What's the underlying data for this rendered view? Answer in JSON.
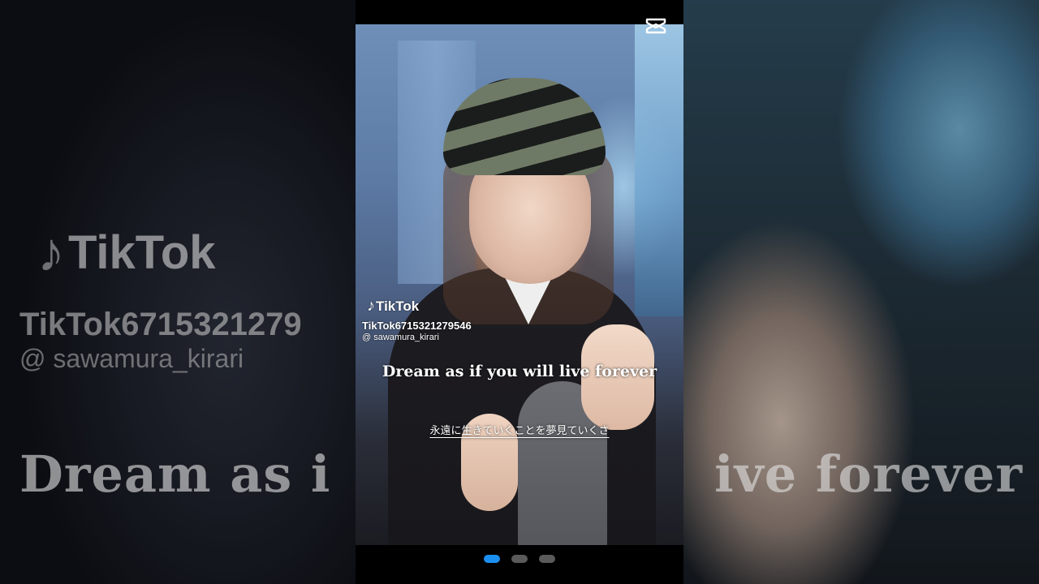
{
  "overlay": {
    "brand": "TikTok",
    "tiktok_id": "TikTok6715321279546",
    "username": "@ sawamura_kirari",
    "caption_en": "Dream as if you will live forever",
    "caption_ja": "永遠に生きていくことを夢見ていくさ"
  },
  "background": {
    "brand": "TikTok",
    "tiktok_id": "TikTok6715321279",
    "username": "@ sawamura_kirari",
    "caption_left": "Dream as i",
    "caption_right": "ive forever"
  },
  "carousel": {
    "count": 3,
    "active_index": 0
  },
  "icons": {
    "watermark": "capcut-logo-icon",
    "brand": "tiktok-note-icon"
  },
  "colors": {
    "active_dot": "#1a8ff0",
    "inactive_dot": "#5a5a5a"
  }
}
